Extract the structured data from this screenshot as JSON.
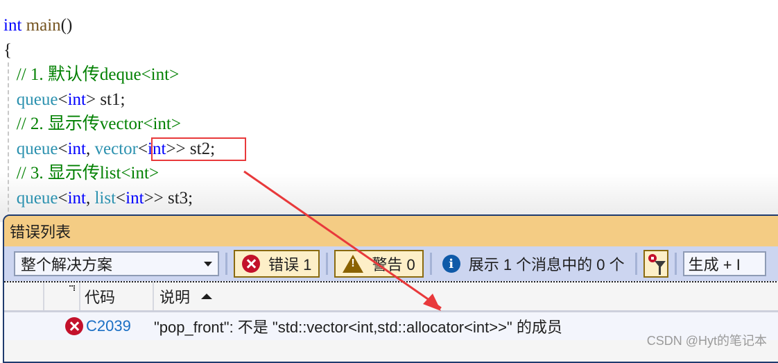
{
  "editor": {
    "lines": [
      {
        "parts": [
          {
            "t": "int",
            "c": "kw"
          },
          {
            "t": " ",
            "c": "tx"
          },
          {
            "t": "main",
            "c": "fn"
          },
          {
            "t": "()",
            "c": "tx"
          }
        ]
      },
      {
        "parts": [
          {
            "t": "{",
            "c": "tx"
          }
        ]
      },
      {
        "parts": [
          {
            "t": "   // 1. 默认传deque<int>",
            "c": "cm"
          }
        ]
      },
      {
        "parts": [
          {
            "t": "   ",
            "c": "tx"
          },
          {
            "t": "queue",
            "c": "ty"
          },
          {
            "t": "<",
            "c": "tx"
          },
          {
            "t": "int",
            "c": "kw"
          },
          {
            "t": "> st1;",
            "c": "tx"
          }
        ]
      },
      {
        "parts": [
          {
            "t": "   // 2. 显示传vector<int>",
            "c": "cm"
          }
        ]
      },
      {
        "parts": [
          {
            "t": "   ",
            "c": "tx"
          },
          {
            "t": "queue",
            "c": "ty"
          },
          {
            "t": "<",
            "c": "tx"
          },
          {
            "t": "int",
            "c": "kw"
          },
          {
            "t": ", ",
            "c": "tx"
          },
          {
            "t": "vector",
            "c": "ty"
          },
          {
            "t": "<",
            "c": "tx"
          },
          {
            "t": "int",
            "c": "kw"
          },
          {
            "t": ">> st2;",
            "c": "tx"
          }
        ]
      },
      {
        "parts": [
          {
            "t": "   // 3. 显示传list<int>",
            "c": "cm"
          }
        ]
      },
      {
        "parts": [
          {
            "t": "   ",
            "c": "tx"
          },
          {
            "t": "queue",
            "c": "ty"
          },
          {
            "t": "<",
            "c": "tx"
          },
          {
            "t": "int",
            "c": "kw"
          },
          {
            "t": ", ",
            "c": "tx"
          },
          {
            "t": "list",
            "c": "ty"
          },
          {
            "t": "<",
            "c": "tx"
          },
          {
            "t": "int",
            "c": "kw"
          },
          {
            "t": ">> st3;",
            "c": "tx"
          }
        ]
      }
    ]
  },
  "error_list": {
    "title": "错误列表",
    "scope": "整个解决方案",
    "errors_label": "错误 1",
    "warnings_label": "警告 0",
    "messages_label": "展示 1 个消息中的 0 个",
    "build_filter": "生成 + I",
    "columns": {
      "code": "代码",
      "description": "说明"
    },
    "rows": [
      {
        "severity": "error",
        "code": "C2039",
        "description": "\"pop_front\": 不是 \"std::vector<int,std::allocator<int>>\" 的成员"
      }
    ]
  },
  "annotation_color": "#e8393b",
  "watermark": "CSDN @Hyt的笔记本"
}
